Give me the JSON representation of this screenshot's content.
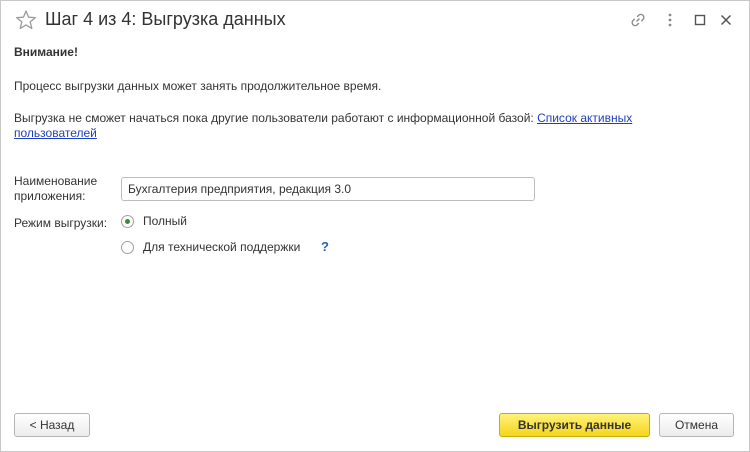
{
  "window": {
    "title": "Шаг 4 из 4: Выгрузка данных",
    "icons": [
      "star-icon",
      "link-icon",
      "more-icon",
      "maximize-icon",
      "close-icon"
    ]
  },
  "content": {
    "warning_title": "Внимание!",
    "text_duration": "Процесс выгрузки данных может занять продолжительное время.",
    "text_users": "Выгрузка не сможет начаться пока другие пользователи работают с информационной базой: ",
    "users_link": "Список активных пользователей"
  },
  "form": {
    "app_name_label": "Наименование приложения:",
    "app_name_value": "Бухгалтерия предприятия, редакция 3.0",
    "mode_label": "Режим выгрузки:",
    "mode_options": [
      {
        "label": "Полный",
        "selected": true
      },
      {
        "label": "Для технической поддержки",
        "selected": false
      }
    ],
    "help_label": "?"
  },
  "buttons": {
    "back": "< Назад",
    "export": "Выгрузить данные",
    "cancel": "Отмена"
  },
  "colors": {
    "accent_button": "#f5d51c",
    "link": "#1f3fbf",
    "radio_selected": "#3a8a3a"
  }
}
